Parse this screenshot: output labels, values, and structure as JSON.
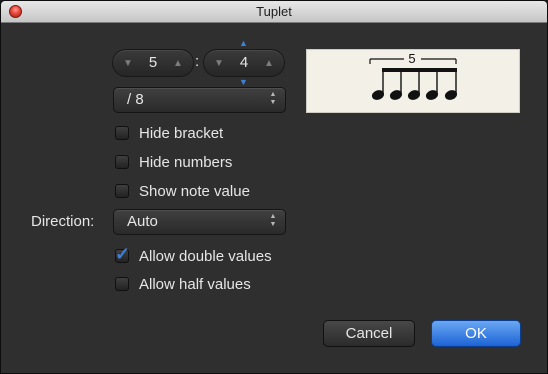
{
  "window": {
    "title": "Tuplet"
  },
  "tuplet": {
    "numerator": "5",
    "denominator": "4",
    "separator": ":",
    "note_value": "/ 8"
  },
  "preview": {
    "tuplet_number": "5"
  },
  "options": {
    "hide_bracket": {
      "label": "Hide bracket",
      "checked": false
    },
    "hide_numbers": {
      "label": "Hide numbers",
      "checked": false
    },
    "show_note_value": {
      "label": "Show note value",
      "checked": false
    },
    "allow_double_values": {
      "label": "Allow double values",
      "checked": true
    },
    "allow_half_values": {
      "label": "Allow half values",
      "checked": false
    }
  },
  "direction": {
    "label": "Direction:",
    "value": "Auto"
  },
  "buttons": {
    "cancel": "Cancel",
    "ok": "OK"
  },
  "icons": {
    "close": "close-button",
    "stepper_down": "▼",
    "stepper_up": "▲",
    "popup_arrows": "▲▼",
    "checkmark": "✓"
  },
  "colors": {
    "accent": "#3b82d6",
    "ok_button": "#2f73e0",
    "background": "#2f2f2f"
  }
}
